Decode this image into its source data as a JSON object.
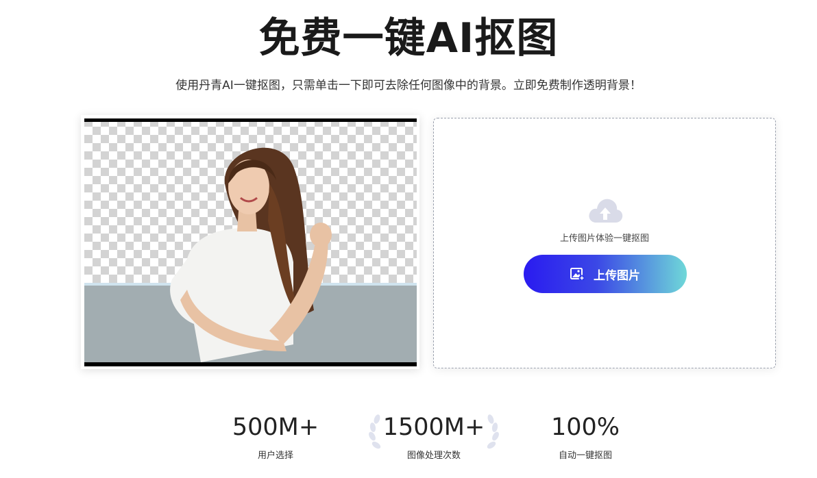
{
  "header": {
    "title": "免费一键AI抠图",
    "subtitle": "使用丹青AI一键抠图，只需单击一下即可去除任何图像中的背景。立即免费制作透明背景！"
  },
  "upload": {
    "hint": "上传图片体验一键抠图",
    "button_label": "上传图片",
    "button_icon": "image-add-icon",
    "cloud_icon": "cloud-upload-icon"
  },
  "stats": [
    {
      "value": "500M+",
      "label": "用户选择"
    },
    {
      "value": "1500M+",
      "label": "图像处理次数"
    },
    {
      "value": "100%",
      "label": "自动一键抠图"
    }
  ],
  "colors": {
    "button_gradient_start": "#2a1bf0",
    "button_gradient_end": "#6fd8d8",
    "laurel": "#dfe2ee"
  }
}
